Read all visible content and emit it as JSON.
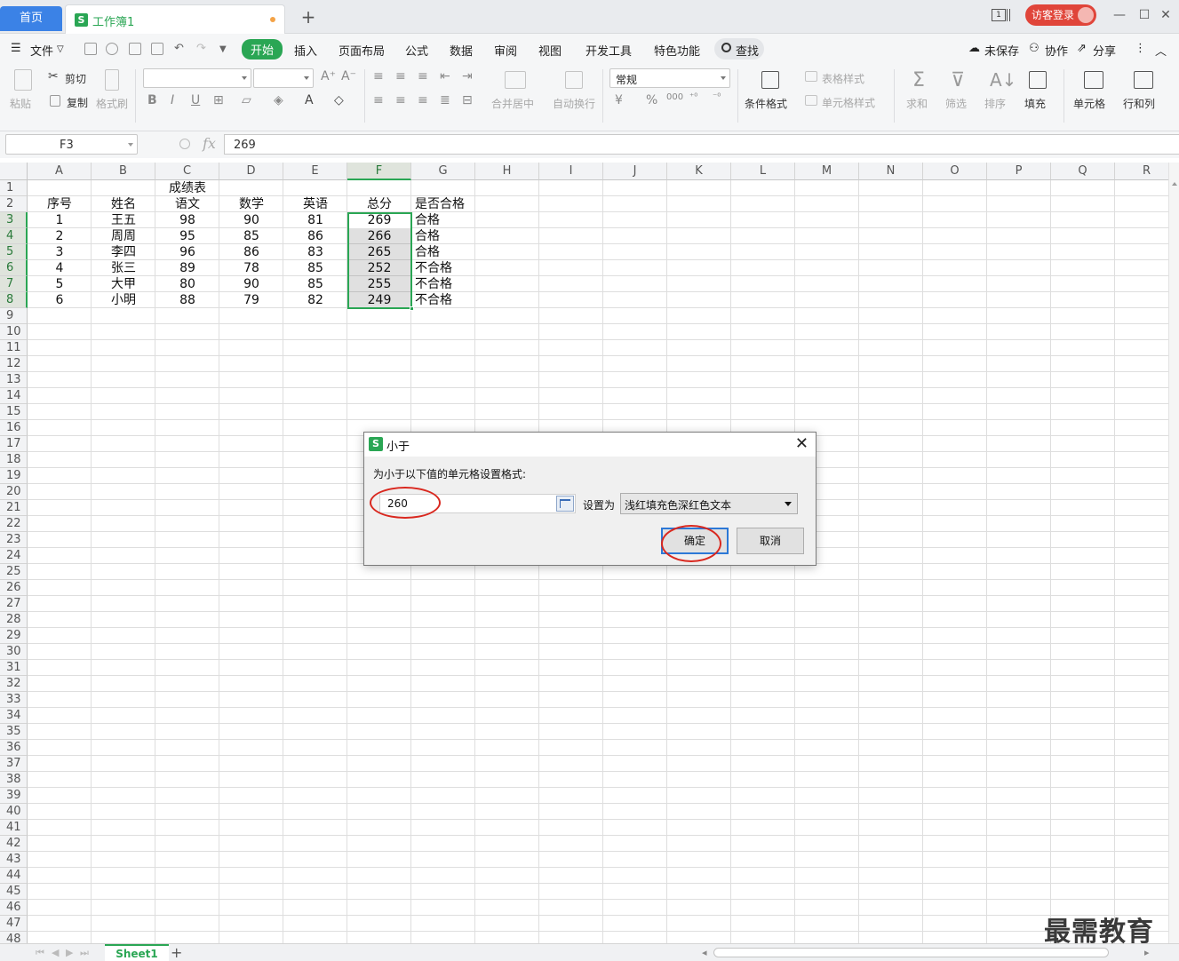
{
  "titlebar": {
    "home_tab": "首页",
    "doc_tab": "工作簿1",
    "app_logo": "S",
    "new_tab": "+",
    "login": "访客登录",
    "page_indicator": "1"
  },
  "menubar": {
    "file": "文件",
    "tabs": [
      "开始",
      "插入",
      "页面布局",
      "公式",
      "数据",
      "审阅",
      "视图",
      "开发工具",
      "特色功能"
    ],
    "search": "查找",
    "unsaved": "未保存",
    "collaborate": "协作",
    "share": "分享"
  },
  "ribbon": {
    "paste": "粘贴",
    "cut": "剪切",
    "copy": "复制",
    "format_painter": "格式刷",
    "merge_center": "合并居中",
    "wrap_text": "自动换行",
    "number_format": "常规",
    "currency": "¥",
    "percent": "%",
    "thousands": "000",
    "cond_format": "条件格式",
    "table_style": "表格样式",
    "cell_style": "单元格样式",
    "sum": "求和",
    "filter": "筛选",
    "sort": "排序",
    "fill": "填充",
    "cell": "单元格",
    "row_col": "行和列"
  },
  "formula_bar": {
    "name_box": "F3",
    "fx": "fx",
    "value": "269"
  },
  "columns": [
    "A",
    "B",
    "C",
    "D",
    "E",
    "F",
    "G",
    "H",
    "I",
    "J",
    "K",
    "L",
    "M",
    "N",
    "O",
    "P",
    "Q",
    "R"
  ],
  "row_count": 48,
  "sheet": {
    "title": "成绩表",
    "headers": [
      "序号",
      "姓名",
      "语文",
      "数学",
      "英语",
      "总分",
      "是否合格"
    ],
    "rows": [
      [
        "1",
        "王五",
        "98",
        "90",
        "81",
        "269",
        "合格"
      ],
      [
        "2",
        "周周",
        "95",
        "85",
        "86",
        "266",
        "合格"
      ],
      [
        "3",
        "李四",
        "96",
        "86",
        "83",
        "265",
        "合格"
      ],
      [
        "4",
        "张三",
        "89",
        "78",
        "85",
        "252",
        "不合格"
      ],
      [
        "5",
        "大甲",
        "80",
        "90",
        "85",
        "255",
        "不合格"
      ],
      [
        "6",
        "小明",
        "88",
        "79",
        "82",
        "249",
        "不合格"
      ]
    ]
  },
  "dialog": {
    "title": "小于",
    "prompt": "为小于以下值的单元格设置格式:",
    "value": "260",
    "set_as_label": "设置为",
    "format_option": "浅红填充色深红色文本",
    "ok": "确定",
    "cancel": "取消"
  },
  "sheet_tabs": {
    "active": "Sheet1",
    "add": "+"
  },
  "watermark": "最需教育",
  "colors": {
    "accent_green": "#2aa654",
    "home_tab_blue": "#3b82e6",
    "login_red": "#e0453a",
    "annotation_red": "#d9281f"
  }
}
